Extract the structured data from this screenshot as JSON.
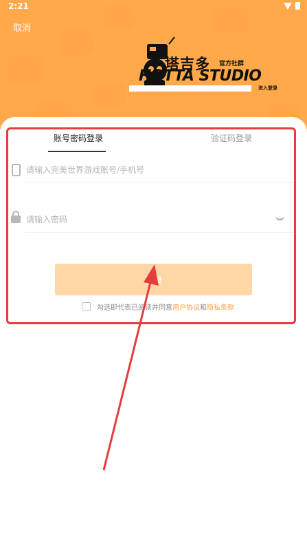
{
  "status": {
    "time": "2:21"
  },
  "header": {
    "cancel_label": "取消",
    "logo": {
      "name_cn": "塔吉多",
      "tag": "官方社群",
      "studio": "HOTTA STUDIO",
      "enter": "进入登录"
    }
  },
  "tabs": [
    {
      "label": "账号密码登录"
    },
    {
      "label": "验证码登录"
    }
  ],
  "form": {
    "account_placeholder": "请输入完美世界游戏账号/手机号",
    "password_placeholder": "请输入密码",
    "login_label": "登录"
  },
  "agreement": {
    "prefix": "勾选即代表已阅读并同意",
    "user_agreement": "用户协议",
    "and": "和",
    "privacy": "隐私条款"
  },
  "colors": {
    "header": "#ffa94b",
    "button": "#ffd7a6",
    "link": "#ff9f43",
    "annotation": "#e53c3c"
  }
}
